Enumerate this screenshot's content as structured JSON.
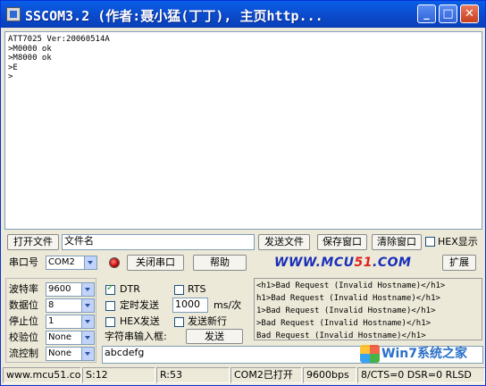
{
  "window": {
    "title": "SSCOM3.2 (作者:聂小猛(丁丁), 主页http..."
  },
  "titlebar_buttons": {
    "minimize": "_",
    "maximize": "□",
    "close": "✕"
  },
  "receive": {
    "text": "ATT7025 Ver:20060514A\n>M0000 ok\n>M8000 ok\n>E\n>"
  },
  "row1": {
    "open_file": "打开文件",
    "file_name": "文件名",
    "send_file": "发送文件",
    "save_window": "保存窗口",
    "clear_window": "清除窗口",
    "hex_display": "HEX显示",
    "hex_display_checked": false
  },
  "row2": {
    "port_label": "串口号",
    "port_value": "COM2",
    "close_port": "关闭串口",
    "help": "帮助",
    "site": "WWW.MCU51.COM",
    "site_red": "51",
    "site_pre": "WWW.MCU",
    "site_post": ".COM",
    "expand": "扩展"
  },
  "settings": {
    "baud_label": "波特率",
    "baud_value": "9600",
    "data_label": "数据位",
    "data_value": "8",
    "stop_label": "停止位",
    "stop_value": "1",
    "parity_label": "校验位",
    "parity_value": "None",
    "flow_label": "流控制",
    "flow_value": "None"
  },
  "send_opts": {
    "dtr": "DTR",
    "dtr_checked": true,
    "rts": "RTS",
    "rts_checked": false,
    "timed_send": "定时发送",
    "timed_checked": false,
    "interval": "1000",
    "interval_unit": "ms/次",
    "hex_send": "HEX发送",
    "hex_checked": false,
    "send_newline": "发送新行",
    "newline_checked": false,
    "input_label": "字符串输入框:",
    "send": "发送",
    "input_value": "abcdefg"
  },
  "history": {
    "text": "<h1>Bad Request (Invalid Hostname)</h1>\nh1>Bad Request (Invalid Hostname)</h1>\n1>Bad Request (Invalid Hostname)</h1>\n>Bad Request (Invalid Hostname)</h1>\nBad Request (Invalid Hostname)</h1>"
  },
  "status": {
    "site": "www.mcu51.cor",
    "sent": "S:12",
    "received": "R:53",
    "port_state": "COM2已打开",
    "baud": "9600bps",
    "lines": "8/CTS=0 DSR=0 RLSD"
  },
  "watermark": {
    "text": "Win7系统之家"
  }
}
